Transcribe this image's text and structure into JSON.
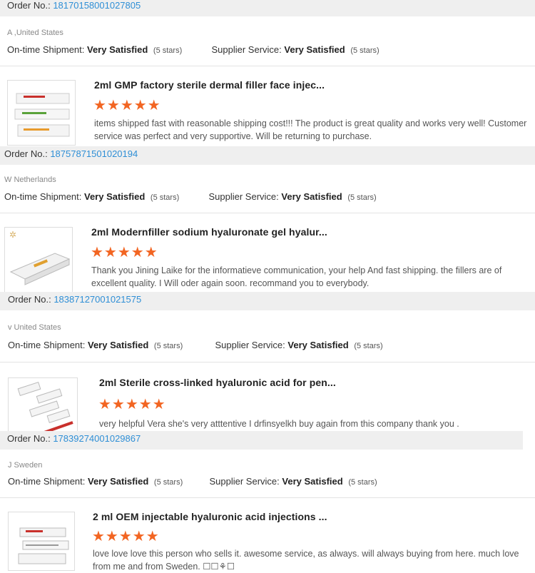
{
  "reviews": [
    {
      "order_label": "Order No.:",
      "order_no": "18170158001027805",
      "customer": "A                  ,United States",
      "shipment_label": "On-time Shipment:",
      "shipment_value": "Very Satisfied",
      "shipment_stars": "(5 stars)",
      "service_label": "Supplier Service:",
      "service_value": "Very Satisfied",
      "service_stars": "(5 stars)",
      "title": "2ml GMP factory sterile dermal filler face injec...",
      "rating": "★★★★★",
      "text": "items shipped fast with reasonable shipping cost!!! The product is great quality and works very well! Customer service was perfect and very supportive. Will be returning to purchase."
    },
    {
      "order_label": "Order No.:",
      "order_no": "18757871501020194",
      "customer": "W                  Netherlands",
      "shipment_label": "On-time Shipment:",
      "shipment_value": "Very Satisfied",
      "shipment_stars": "(5 stars)",
      "service_label": "Supplier Service:",
      "service_value": "Very Satisfied",
      "service_stars": "(5 stars)",
      "title": "2ml Modernfiller sodium hyaluronate gel hyalur...",
      "rating": "★★★★★",
      "text": "Thank you Jining Laike for the informatieve communication, your help And fast shipping. the fillers  are of excellent quality.   I Will oder again soon. recommand you to everybody."
    },
    {
      "order_label": "Order No.:",
      "order_no": "18387127001021575",
      "customer": "v                  United States",
      "shipment_label": "On-time Shipment:",
      "shipment_value": "Very Satisfied",
      "shipment_stars": "(5 stars)",
      "service_label": "Supplier Service:",
      "service_value": "Very Satisfied",
      "service_stars": "(5 stars)",
      "title": "2ml Sterile cross-linked hyaluronic acid for pen...",
      "rating": "★★★★★",
      "text": "very helpful Vera she's very atttentive I drfinsyelkh buy again from this company thank you ."
    },
    {
      "order_label": "Order No.:",
      "order_no": "17839274001029867",
      "customer": "J              Sweden",
      "shipment_label": "On-time Shipment:",
      "shipment_value": "Very Satisfied",
      "shipment_stars": "(5 stars)",
      "service_label": "Supplier Service:",
      "service_value": "Very Satisfied",
      "service_stars": "(5 stars)",
      "title": "2 ml OEM injectable hyaluronic acid injections ...",
      "rating": "★★★★★",
      "text": "love love love this person who sells it. awesome service, as always. will always buying from here. much love from me and from Sweden.  ☐☐⚘☐"
    }
  ]
}
